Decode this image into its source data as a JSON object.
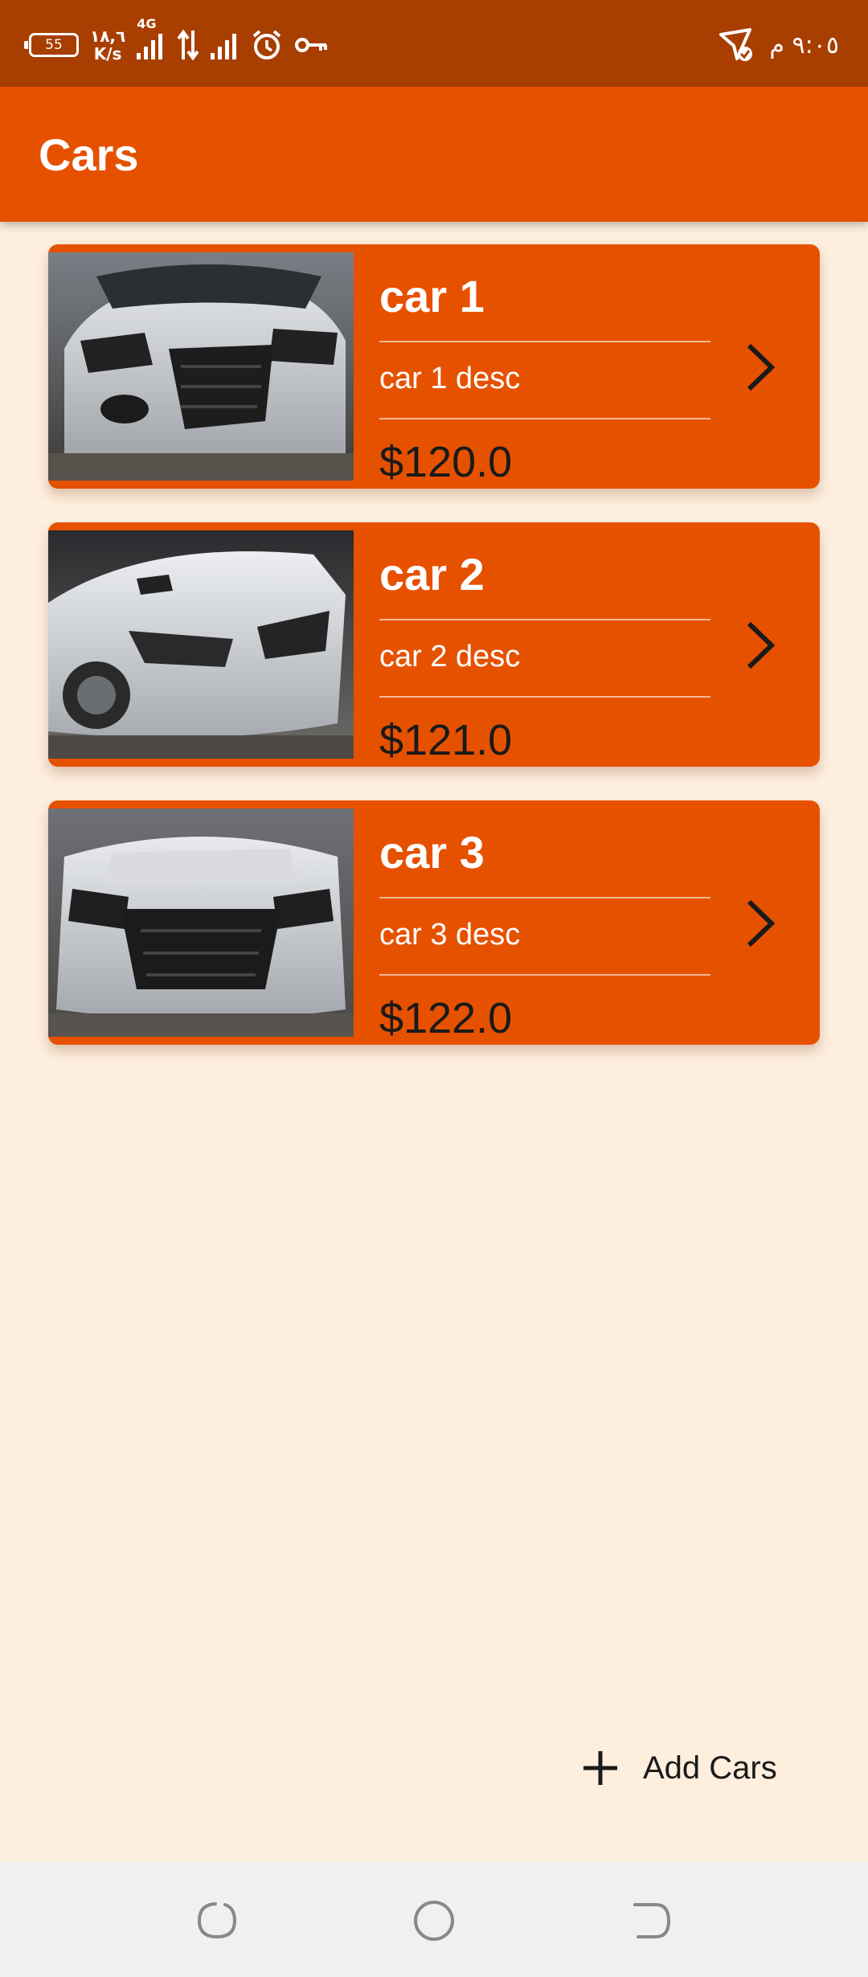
{
  "status_bar": {
    "battery": "55",
    "net_speed_value": "١٨,٦",
    "net_speed_unit": "K/s",
    "network_type": "4G",
    "time": "٩:٠٥ م"
  },
  "app_bar": {
    "title": "Cars"
  },
  "cars": [
    {
      "name": "car 1",
      "desc": "car 1 desc",
      "price": "$120.0"
    },
    {
      "name": "car 2",
      "desc": "car 2 desc",
      "price": "$121.0"
    },
    {
      "name": "car 3",
      "desc": "car 3 desc",
      "price": "$122.0"
    }
  ],
  "fab": {
    "label": "Add Cars",
    "icon": "plus-icon"
  },
  "colors": {
    "status_bar": "#a83e00",
    "primary": "#e65100",
    "background": "#fdeedd",
    "nav_bar": "#f0f0f0"
  },
  "icons": {
    "card_action": "chevron-right-icon",
    "nav": [
      "recent-apps-icon",
      "home-icon",
      "back-icon"
    ]
  }
}
